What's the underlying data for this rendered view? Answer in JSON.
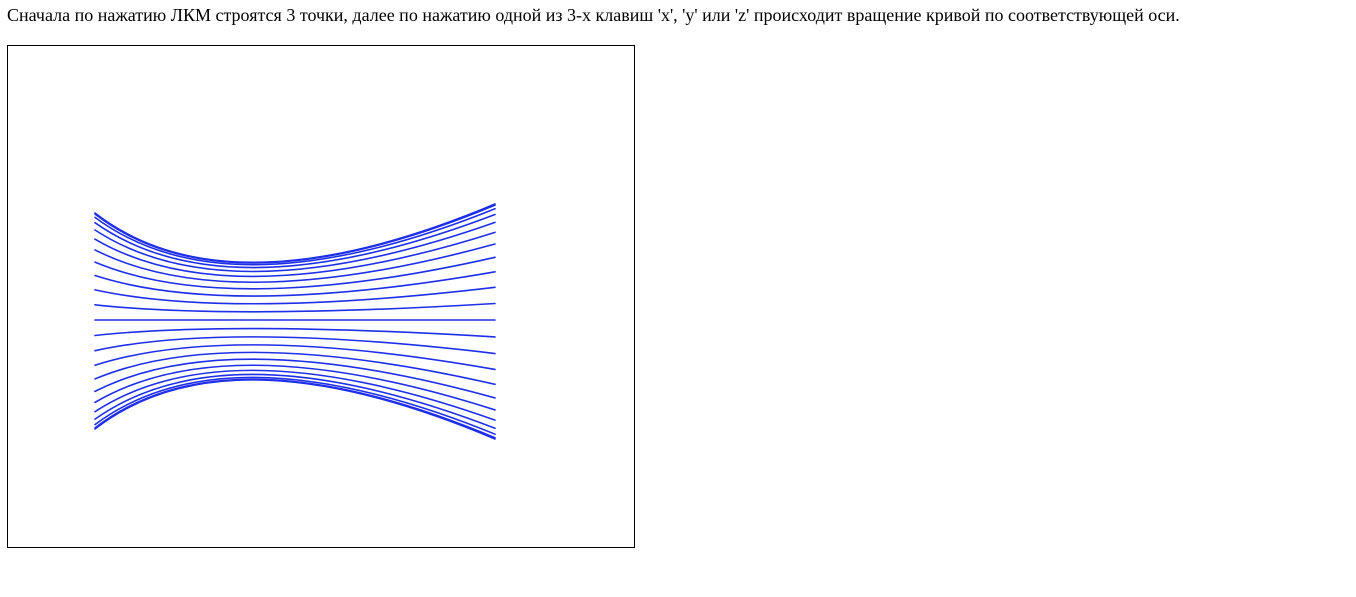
{
  "instruction": "Сначала по нажатию ЛКМ строятся 3 точки, далее по нажатию одной из 3-х клавиш 'x', 'y' или 'z' происходит вращение кривой по соответствующей оси.",
  "canvas": {
    "stroke_color": "#1f2fe8",
    "curve_icon": "bezier-curve-lines",
    "curve_count": 23
  }
}
